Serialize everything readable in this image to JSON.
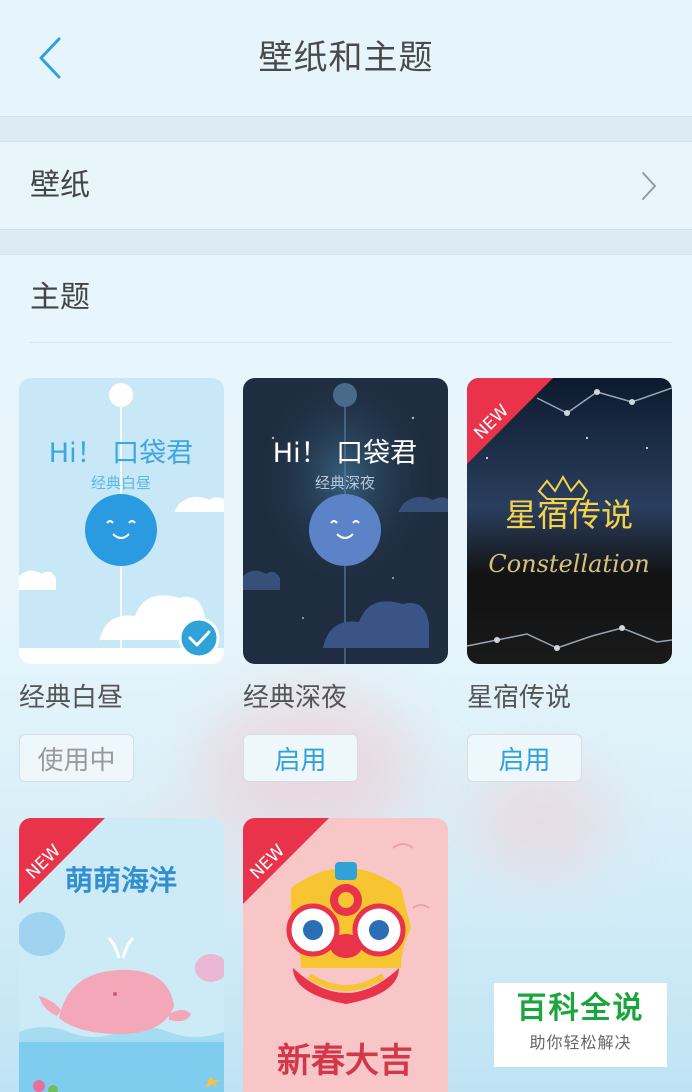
{
  "header": {
    "title": "壁纸和主题",
    "back_icon": "chevron-left-icon"
  },
  "wallpaper_row": {
    "label": "壁纸",
    "icon": "chevron-right-icon"
  },
  "themes": {
    "heading": "主题",
    "items": [
      {
        "name": "经典白昼",
        "button": "使用中",
        "status": "in-use",
        "preview_title": "Hi！ 口袋君",
        "preview_subtitle": "经典白昼",
        "selected": true
      },
      {
        "name": "经典深夜",
        "button": "启用",
        "status": "available",
        "preview_title": "Hi！ 口袋君",
        "preview_subtitle": "经典深夜",
        "selected": false
      },
      {
        "name": "星宿传说",
        "button": "启用",
        "status": "available",
        "preview_title": "星宿传说",
        "preview_subtitle": "Constellation",
        "badge": "NEW"
      },
      {
        "name": "",
        "preview_title": "萌萌海洋",
        "badge": "NEW"
      },
      {
        "name": "",
        "preview_title": "新春大吉",
        "badge": "NEW"
      }
    ]
  },
  "watermark": {
    "main": "百科全说",
    "sub": "助你轻松解决"
  },
  "colors": {
    "accent": "#2fa3d8",
    "background": "#e6f5fb",
    "badge_red": "#e8334a",
    "watermark_green": "#1aa63c"
  }
}
